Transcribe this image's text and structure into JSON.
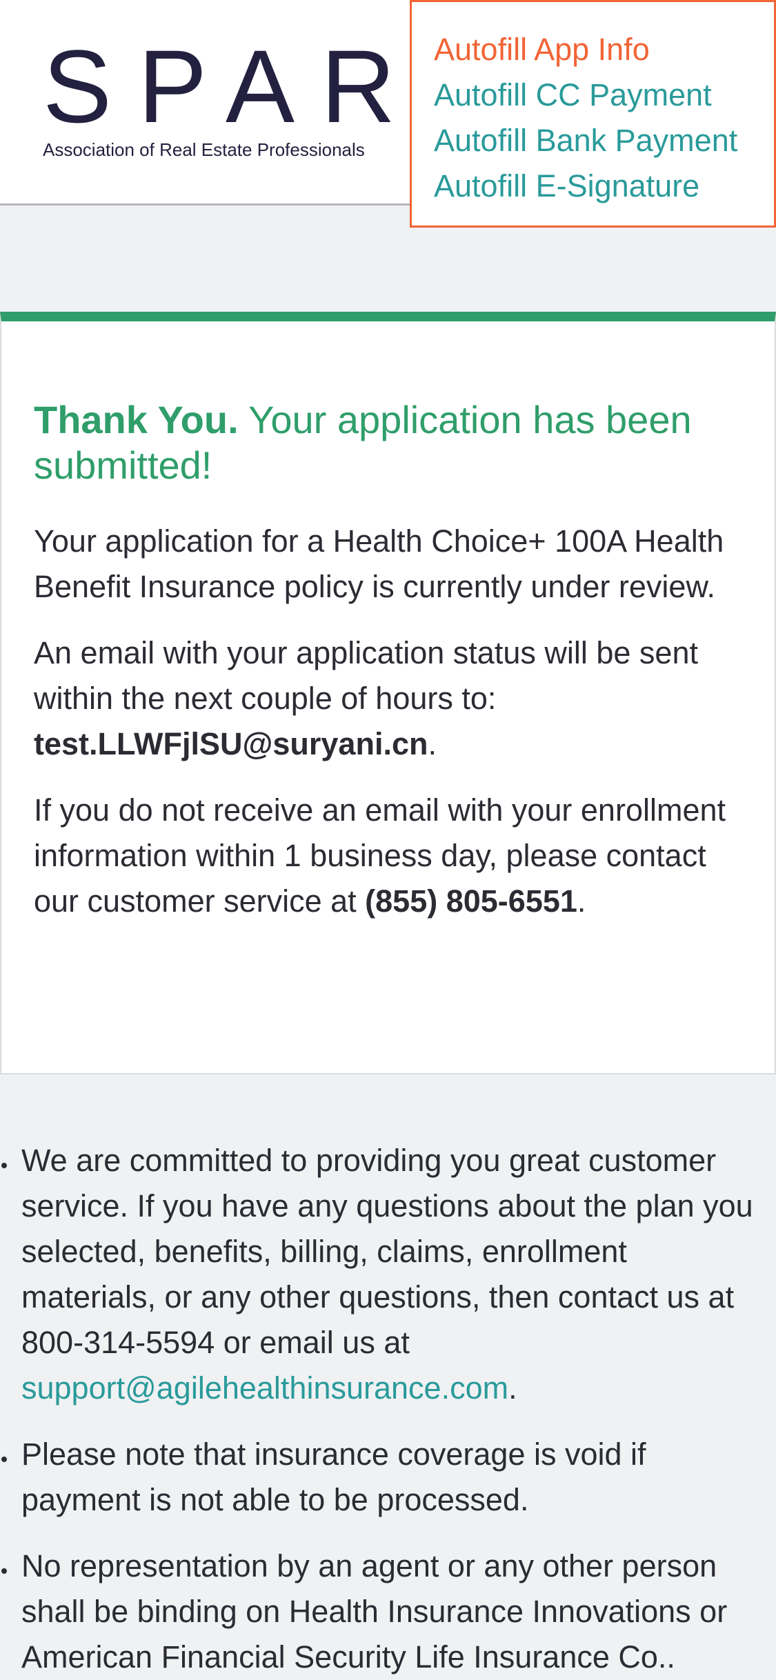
{
  "header": {
    "logo_word": "SPARK",
    "logo_subtitle": "Association of Real Estate Professionals"
  },
  "autofill_menu": {
    "items": [
      {
        "label": "Autofill App Info"
      },
      {
        "label": "Autofill CC Payment"
      },
      {
        "label": "Autofill Bank Payment"
      },
      {
        "label": "Autofill E-Signature"
      }
    ],
    "colors": {
      "active": "#f26436",
      "link": "#2a9a9a"
    }
  },
  "confirmation": {
    "title_strong": "Thank You.",
    "title_rest": " Your application has been submitted!",
    "p1": "Your application for a Health Choice+ 100A Health Benefit Insurance policy is currently under review.",
    "p2_text": "An email with your application status will be sent within the next couple of hours to: ",
    "p2_email": "test.LLWFjlSU@suryani.cn",
    "p2_end": ".",
    "p3_text": "If you do not receive an email with your enrollment information within 1 business day, please contact our customer service at ",
    "p3_phone": "(855) 805-6551",
    "p3_end": ".",
    "accent_color": "#2f9e6a"
  },
  "info": {
    "b1_text": "We are committed to providing you great customer service. If you have any questions about the plan you selected, benefits, billing, claims, enrollment materials, or any other questions, then contact us at 800-314-5594 or email us at ",
    "b1_link": "support@agilehealthinsurance.com",
    "b1_end": ".",
    "b2": "Please note that insurance coverage is void if payment is not able to be processed.",
    "b3": "No representation by an agent or any other person shall be binding on Health Insurance Innovations or American Financial Security Life Insurance Co.."
  }
}
